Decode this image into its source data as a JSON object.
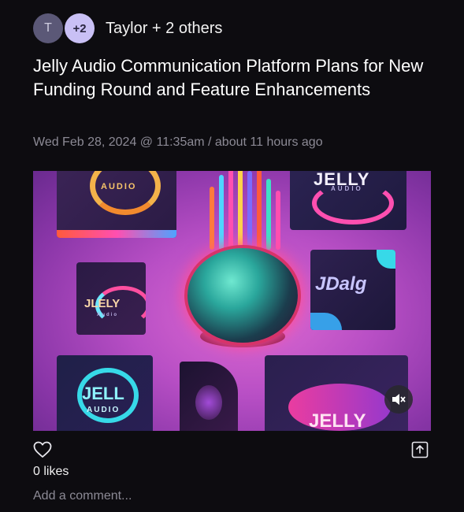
{
  "post": {
    "avatar_initial": "T",
    "extra_count": "+2",
    "author_line": "Taylor + 2 others",
    "title": "Jelly Audio Communication Platform Plans for New Funding Round and Feature Enhancements",
    "timestamp": "Wed Feb 28, 2024 @ 11:35am / about 11 hours ago"
  },
  "media": {
    "logos": [
      "AUDIO",
      "JELLY",
      "AUDIO",
      "JLELY",
      "Audio",
      "JDalg",
      "JELL",
      "AUDIO",
      "JELLY"
    ],
    "mute_icon": "speaker-muted-icon"
  },
  "actions": {
    "like_icon": "heart-icon",
    "share_icon": "share-icon",
    "likes_text": "0 likes",
    "comment_placeholder": "Add a comment..."
  },
  "colors": {
    "background": "#0d0c10",
    "secondary_text": "#8c8a95",
    "avatar_accent": "#c9c0f5"
  }
}
